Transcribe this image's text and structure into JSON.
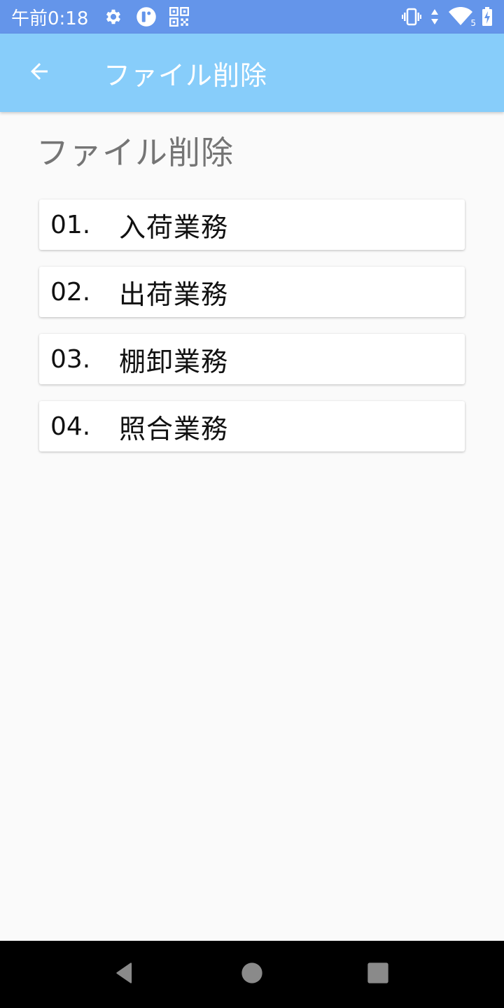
{
  "status_bar": {
    "time": "午前0:18",
    "icons_left": [
      "settings-icon",
      "app-notification-icon",
      "qr-code-icon"
    ],
    "icons_right": [
      "vibrate-icon",
      "data-arrows-icon",
      "wifi-icon",
      "battery-charging-icon"
    ],
    "wifi_badge": "5"
  },
  "app_bar": {
    "back_icon": "arrow-left-icon",
    "title": "ファイル削除"
  },
  "page": {
    "heading": "ファイル削除"
  },
  "menu": {
    "items": [
      {
        "number": "01.",
        "label": "入荷業務"
      },
      {
        "number": "02.",
        "label": "出荷業務"
      },
      {
        "number": "03.",
        "label": "棚卸業務"
      },
      {
        "number": "04.",
        "label": "照合業務"
      }
    ]
  },
  "colors": {
    "status_bar": "#6495ea",
    "app_bar": "#87cdfa",
    "background": "#fafafa",
    "heading_text": "#757575"
  },
  "nav_bar": {
    "buttons": [
      "back-triangle-icon",
      "home-circle-icon",
      "recents-square-icon"
    ]
  }
}
